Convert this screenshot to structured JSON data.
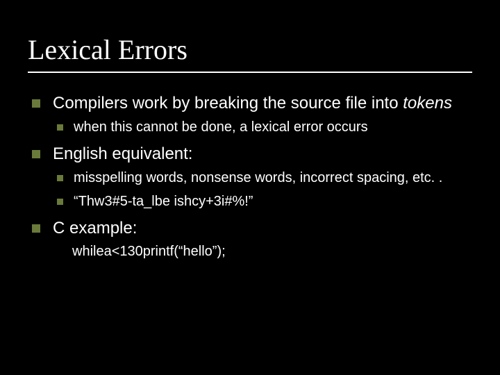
{
  "slide": {
    "title": "Lexical Errors",
    "bullets": [
      {
        "text_pre": "Compilers work by breaking the source file into ",
        "text_italic": "tokens",
        "sub": [
          {
            "text": "when this cannot be done, a lexical error occurs"
          }
        ]
      },
      {
        "text": "English equivalent:",
        "sub": [
          {
            "text": "misspelling words, nonsense words, incorrect spacing, etc. ."
          },
          {
            "text": "“Thw3#5-ta_lbe ishcy+3i#%!”"
          }
        ]
      },
      {
        "text": "C example:",
        "sub3": [
          {
            "text": "whilea<130printf(“hello”);"
          }
        ]
      }
    ]
  }
}
